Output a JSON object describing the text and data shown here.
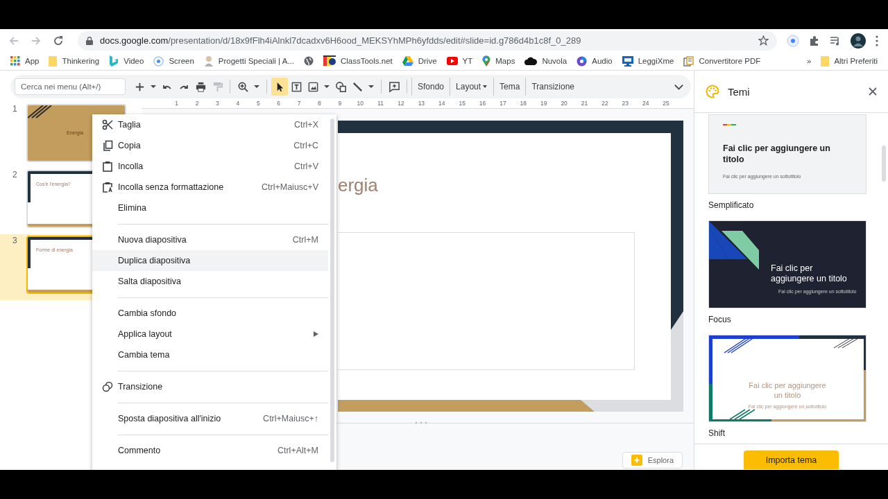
{
  "browser": {
    "url": {
      "host": "docs.google.com",
      "path": "/presentation/d/18x9fFlh4iAlnkl7dcadxv6H6ood_MEKSYhMPh6yfdds/edit#slide=id.g786d4b1c8f_0_289"
    }
  },
  "bookmarks": [
    {
      "kind": "apps",
      "label": "App"
    },
    {
      "kind": "folder",
      "label": "Thinkering"
    },
    {
      "kind": "logo-teal",
      "label": "Video"
    },
    {
      "kind": "radio",
      "label": "Screen"
    },
    {
      "kind": "person",
      "label": "Progetti Speciali | A..."
    },
    {
      "kind": "globe"
    },
    {
      "kind": "logo-multi",
      "label": "ClassTools.net"
    },
    {
      "kind": "triangle",
      "label": "Drive"
    },
    {
      "kind": "play",
      "label": "YT"
    },
    {
      "kind": "pin",
      "label": "Maps"
    },
    {
      "kind": "cloud",
      "label": "Nuvola"
    },
    {
      "kind": "disc",
      "label": "Audio"
    },
    {
      "kind": "monitor",
      "label": "LeggiXme"
    },
    {
      "kind": "document",
      "label": "Convertitore PDF"
    }
  ],
  "bookmarks_overflow": "»",
  "other_bookmarks": "Altri Preferiti",
  "toolbar": {
    "search": {
      "placeholder": "Cerca nei menu (Alt+/)"
    },
    "tools": [
      {
        "kind": "add",
        "selected": false
      },
      {
        "kind": "caret",
        "selected": false
      },
      {
        "kind": "undo",
        "selected": false
      },
      {
        "kind": "redo",
        "selected": false
      },
      {
        "kind": "print",
        "selected": false
      },
      {
        "kind": "paint",
        "selected": false
      },
      {
        "kind": "separator"
      },
      {
        "kind": "zoom",
        "selected": false
      },
      {
        "kind": "caret",
        "selected": false
      },
      {
        "kind": "separator"
      },
      {
        "kind": "select",
        "selected": true
      },
      {
        "kind": "textbox",
        "selected": false
      },
      {
        "kind": "image",
        "selected": false
      },
      {
        "kind": "caret",
        "selected": false
      },
      {
        "kind": "shape",
        "selected": false
      },
      {
        "kind": "line",
        "selected": false
      },
      {
        "kind": "caret",
        "selected": false
      },
      {
        "kind": "separator"
      },
      {
        "kind": "comment",
        "selected": false
      }
    ],
    "buttons": [
      {
        "label": "Sfondo",
        "dropdown": false
      },
      {
        "label": "Layout",
        "dropdown": true
      },
      {
        "label": "Tema",
        "dropdown": false
      },
      {
        "label": "Transizione",
        "dropdown": false
      }
    ]
  },
  "ruler": [
    "1",
    "2",
    "3",
    "4",
    "5",
    "6",
    "7",
    "8",
    "9",
    "10",
    "11",
    "12",
    "13",
    "14",
    "15",
    "16",
    "17",
    "18",
    "19",
    "20",
    "21",
    "22",
    "23",
    "24",
    "25"
  ],
  "slides": [
    {
      "number": "1",
      "kind": "title",
      "text": "Energia",
      "selected": false
    },
    {
      "number": "2",
      "kind": "content",
      "text": "Cos'è l'energia?",
      "selected": false
    },
    {
      "number": "3",
      "kind": "content",
      "text": "Forme di energia",
      "selected": true
    }
  ],
  "editor": {
    "title": "ergia"
  },
  "explore_button": "Esplora",
  "context_menu": [
    {
      "kind": "cut",
      "label": "Taglia",
      "shortcut": "Ctrl+X",
      "selected": false,
      "submenu": false
    },
    {
      "kind": "copy",
      "label": "Copia",
      "shortcut": "Ctrl+C",
      "selected": false,
      "submenu": false
    },
    {
      "kind": "paste",
      "label": "Incolla",
      "shortcut": "Ctrl+V",
      "selected": false,
      "submenu": false
    },
    {
      "kind": "paste-plain",
      "label": "Incolla senza formattazione",
      "shortcut": "Ctrl+Maiusc+V",
      "selected": false,
      "submenu": false
    },
    {
      "kind": "plain",
      "label": "Elimina",
      "selected": false,
      "submenu": false
    },
    {
      "kind": "separator"
    },
    {
      "kind": "plain",
      "label": "Nuova diapositiva",
      "shortcut": "Ctrl+M",
      "selected": false,
      "submenu": false
    },
    {
      "kind": "plain",
      "label": "Duplica diapositiva",
      "selected": true,
      "submenu": false
    },
    {
      "kind": "plain",
      "label": "Salta diapositiva",
      "selected": false,
      "submenu": false
    },
    {
      "kind": "separator"
    },
    {
      "kind": "plain",
      "label": "Cambia sfondo",
      "selected": false,
      "submenu": false
    },
    {
      "kind": "plain",
      "label": "Applica layout",
      "selected": false,
      "submenu": true
    },
    {
      "kind": "plain",
      "label": "Cambia tema",
      "selected": false,
      "submenu": false
    },
    {
      "kind": "separator"
    },
    {
      "kind": "transition",
      "label": "Transizione",
      "selected": false,
      "submenu": false
    },
    {
      "kind": "separator"
    },
    {
      "kind": "plain",
      "label": "Sposta diapositiva all'inizio",
      "shortcut": "Ctrl+Maiusc+↑",
      "selected": false,
      "submenu": false
    },
    {
      "kind": "separator"
    },
    {
      "kind": "plain",
      "label": "Commento",
      "shortcut": "Ctrl+Alt+M",
      "selected": false,
      "submenu": false
    }
  ],
  "theme_panel": {
    "title": "Temi",
    "themes": [
      {
        "kind": "simple",
        "name": "Semplificato",
        "preview_title": "Fai clic per aggiungere un titolo",
        "preview_subtitle": "Fai clic per aggiungere un sottotitolo"
      },
      {
        "kind": "focus",
        "name": "Focus",
        "preview_title": "Fai clic per aggiungere un titolo",
        "preview_subtitle": "Fai clic per aggiungere un sottotitolo"
      },
      {
        "kind": "shift",
        "name": "Shift",
        "preview_title": "Fai clic per aggiungere un titolo",
        "preview_subtitle": "Fai clic per aggiungere un sottotitolo"
      }
    ],
    "import_button": "Importa tema"
  }
}
